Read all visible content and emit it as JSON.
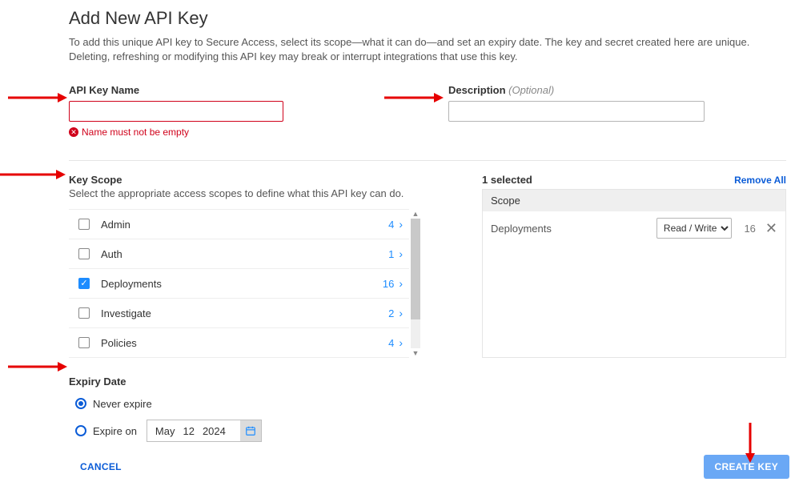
{
  "title": "Add New API Key",
  "description": "To add this unique API key to Secure Access, select its scope—what it can do—and set an expiry date. The key and secret created here are unique. Deleting, refreshing or modifying this API key may break or interrupt integrations that use this key.",
  "fields": {
    "api_key_name_label": "API Key Name",
    "api_key_name_value": "",
    "api_key_name_error": "Name must not be empty",
    "description_label": "Description",
    "description_optional": "(Optional)",
    "description_value": ""
  },
  "key_scope": {
    "label": "Key Scope",
    "sub": "Select the appropriate access scopes to define what this API key can do.",
    "items": [
      {
        "name": "Admin",
        "count": "4",
        "checked": false
      },
      {
        "name": "Auth",
        "count": "1",
        "checked": false
      },
      {
        "name": "Deployments",
        "count": "16",
        "checked": true
      },
      {
        "name": "Investigate",
        "count": "2",
        "checked": false
      },
      {
        "name": "Policies",
        "count": "4",
        "checked": false
      }
    ]
  },
  "selected": {
    "count_label": "1 selected",
    "remove_all": "Remove All",
    "header": "Scope",
    "rows": [
      {
        "name": "Deployments",
        "perm": "Read / Write",
        "count": "16"
      }
    ]
  },
  "expiry": {
    "label": "Expiry Date",
    "never": "Never expire",
    "expire_on": "Expire on",
    "date_month": "May",
    "date_day": "12",
    "date_year": "2024",
    "selected": "never"
  },
  "buttons": {
    "cancel": "CANCEL",
    "create": "CREATE KEY"
  }
}
